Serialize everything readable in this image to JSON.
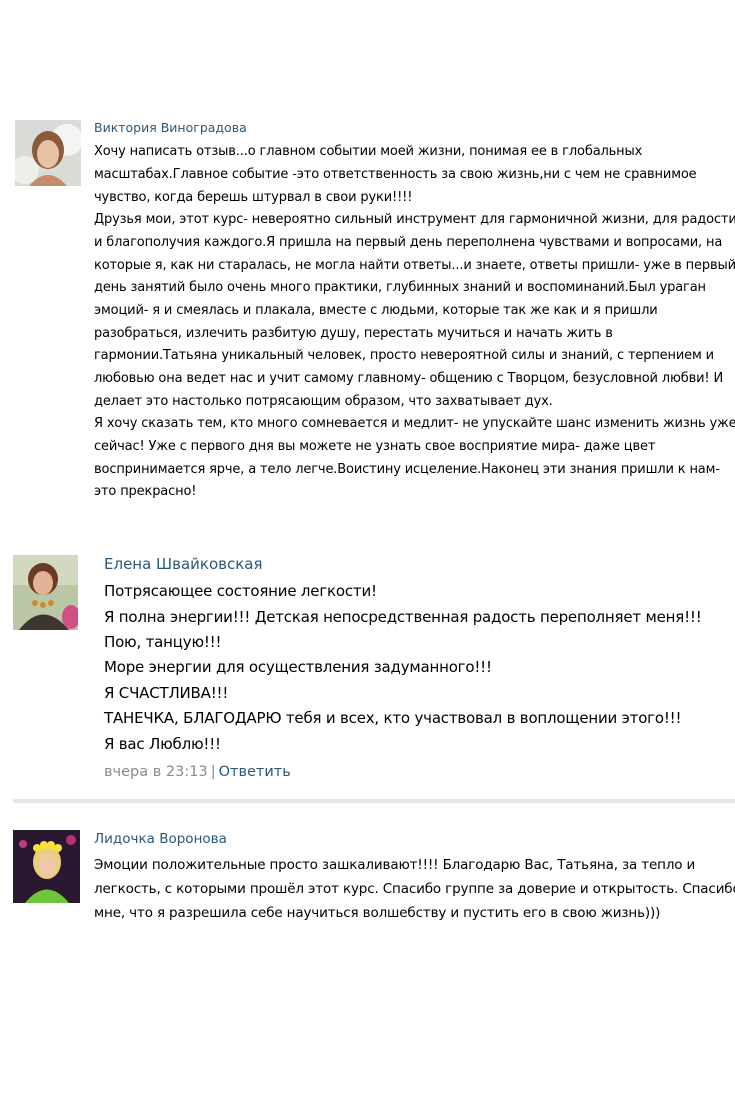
{
  "comments": [
    {
      "author": "Виктория Виноградова",
      "lines": [
        "Хочу написать отзыв...о главном событии моей жизни, понимая ее в глобальных",
        "масштабах.Главное событие -это ответственность за свою жизнь,ни с чем не сравнимое",
        "чувство, когда берешь штурвал в свои руки!!!!",
        "Друзья мои, этот курс- невероятно сильный инструмент для гармоничной жизни, для радости",
        "и благополучия каждого.Я пришла на первый день переполнена чувствами и вопросами, на",
        "которые я, как ни старалась, не могла найти ответы...и знаете, ответы пришли- уже в первый",
        "день занятий было очень много практики, глубинных знаний и воспоминаний.Был ураган",
        "эмоций- я и смеялась и плакала, вместе с людьми, которые так же как и я пришли",
        "разобраться, излечить разбитую душу, перестать мучиться и начать жить в",
        "гармонии.Татьяна уникальный человек, просто невероятной силы и знаний, с терпением и",
        "любовью она ведет нас и учит самому главному- общению с Творцом, безусловной любви! И",
        "делает это настолько потрясающим образом, что захватывает дух.",
        "Я хочу сказать тем, кто много сомневается и медлит- не упускайте шанс изменить жизнь уже",
        "сейчас! Уже с первого дня вы можете не узнать свое восприятие мира- даже цвет",
        "воспринимается ярче, а тело легче.Воистину исцеление.Наконец эти знания пришли к нам-",
        "это прекрасно!"
      ]
    },
    {
      "author": "Елена Швайковская",
      "lines": [
        "Потрясающее состояние легкости!",
        "Я полна энергии!!! Детская непосредственная радость переполняет меня!!!",
        "Пою, танцую!!!",
        "Море энергии для осуществления задуманного!!!",
        "Я СЧАСТЛИВА!!!",
        "ТАНЕЧКА, БЛАГОДАРЮ тебя и всех, кто участвовал в воплощении этого!!!",
        "Я вас Люблю!!!"
      ],
      "time": "вчера в 23:13",
      "separator": "|",
      "reply_label": "Ответить"
    },
    {
      "author": "Лидочка Воронова",
      "lines": [
        "Эмоции положительные просто зашкаливают!!!! Благодарю Вас, Татьяна, за тепло и",
        "легкость, с которыми прошёл этот курс. Спасибо группе за доверие и открытость. Спасибо",
        "мне, что я разрешила себе научиться волшебству и пустить его в свою жизнь)))"
      ]
    }
  ],
  "colors": {
    "author": "#2b587a",
    "link": "#2b587a",
    "muted": "#8a8a8a",
    "divider": "#e6e6e6"
  }
}
